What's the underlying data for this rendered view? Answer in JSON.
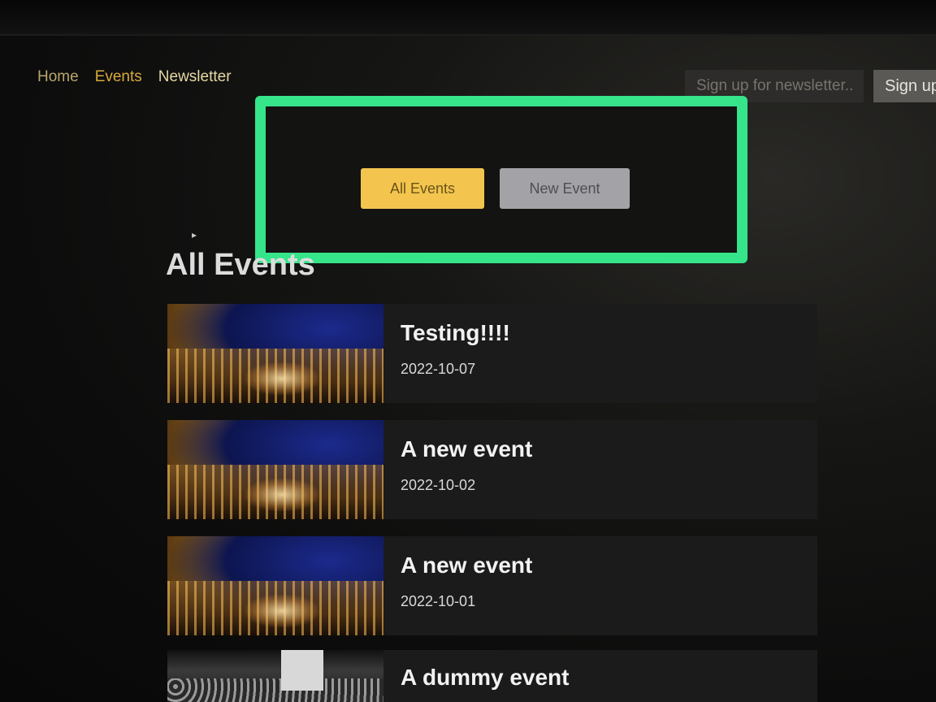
{
  "nav": {
    "home": "Home",
    "events": "Events",
    "newsletter": "Newsletter"
  },
  "newsletter_form": {
    "placeholder": "Sign up for newsletter..",
    "button": "Sign up"
  },
  "tabs": {
    "all_events": "All Events",
    "new_event": "New Event"
  },
  "section_title": "All Events",
  "events": [
    {
      "title": "Testing!!!!",
      "date": "2022-10-07"
    },
    {
      "title": "A new event",
      "date": "2022-10-02"
    },
    {
      "title": "A new event",
      "date": "2022-10-01"
    },
    {
      "title": "A dummy event",
      "date": ""
    }
  ],
  "colors": {
    "highlight": "#36e48a",
    "accent": "#f3c54f",
    "secondary_button": "#a3a2a6"
  }
}
